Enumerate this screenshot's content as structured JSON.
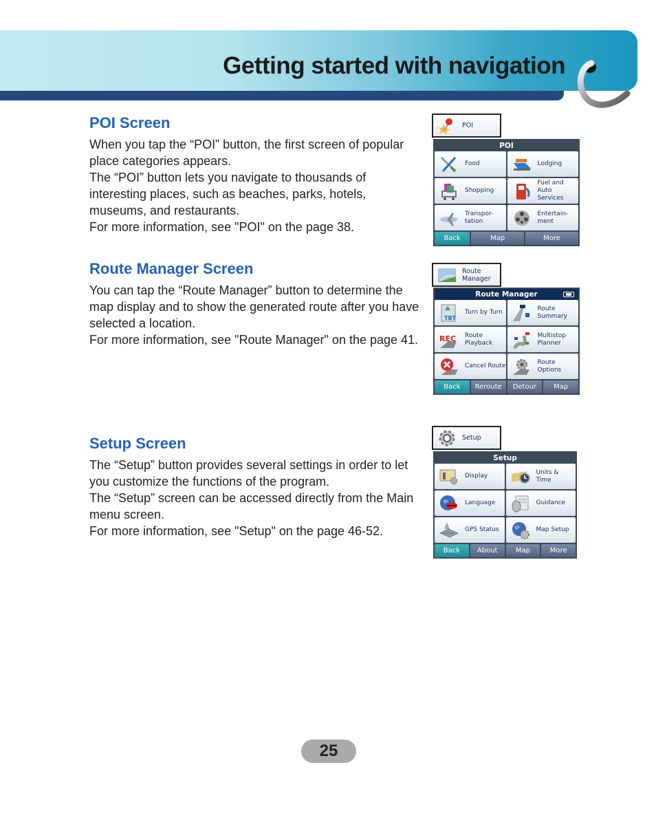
{
  "header": {
    "title": "Getting started with navigation"
  },
  "sections": [
    {
      "heading": "POI Screen",
      "paragraphs": [
        "When you tap the “POI” button, the first screen of popular place categories appears.",
        "The “POI” button lets you navigate to thousands of interesting places, such as beaches, parks, hotels, museums, and restaurants.",
        "For more information, see \"POI\" on the page 38."
      ]
    },
    {
      "heading": "Route Manager Screen",
      "paragraphs": [
        "You can tap the “Route Manager” button to determine the map display and to show the generated route after you have selected a location.",
        "For more information, see \"Route Manager\" on the page 41."
      ]
    },
    {
      "heading": "Setup Screen",
      "paragraphs": [
        "The “Setup” button provides several settings in order to let you customize the functions of the program.",
        "The “Setup” screen can be accessed directly from the Main menu screen.",
        "For more information, see \"Setup\" on the page 46-52."
      ]
    }
  ],
  "screens": {
    "poi": {
      "shortcut_label": "POI",
      "shortcut_icon": "pushpin-star-icon",
      "title": "POI",
      "tiles": [
        {
          "label": "Food",
          "icon": "fork-knife-icon"
        },
        {
          "label": "Lodging",
          "icon": "bed-icon"
        },
        {
          "label": "Shopping",
          "icon": "shopping-cart-icon"
        },
        {
          "label": "Fuel and Auto Services",
          "icon": "fuel-pump-icon"
        },
        {
          "label": "Transpor-tation",
          "icon": "airplane-icon"
        },
        {
          "label": "Entertain-ment",
          "icon": "film-reel-icon"
        }
      ],
      "buttons": [
        "Back",
        "Map",
        "More"
      ]
    },
    "route_manager": {
      "shortcut_label": "Route Manager",
      "shortcut_icon": "route-map-icon",
      "title": "Route Manager",
      "tiles": [
        {
          "label": "Turn by Turn",
          "icon": "turn-by-turn-icon"
        },
        {
          "label": "Route Summary",
          "icon": "route-summary-icon"
        },
        {
          "label": "Route Playback",
          "icon": "rec-playback-icon"
        },
        {
          "label": "Multistop Planner",
          "icon": "multistop-flags-icon"
        },
        {
          "label": "Cancel Route",
          "icon": "cancel-x-icon"
        },
        {
          "label": "Route Options",
          "icon": "route-gear-icon"
        }
      ],
      "buttons": [
        "Back",
        "Reroute",
        "Detour",
        "Map"
      ]
    },
    "setup": {
      "shortcut_label": "Setup",
      "shortcut_icon": "gear-icon",
      "title": "Setup",
      "tiles": [
        {
          "label": "Display",
          "icon": "display-icon"
        },
        {
          "label": "Units & Time",
          "icon": "clock-ruler-icon"
        },
        {
          "label": "Language",
          "icon": "globe-lips-icon"
        },
        {
          "label": "Guidance",
          "icon": "speaker-icon"
        },
        {
          "label": "GPS Status",
          "icon": "satellite-icon"
        },
        {
          "label": "Map Setup",
          "icon": "globe-gear-icon"
        }
      ],
      "buttons": [
        "Back",
        "About",
        "Map",
        "More"
      ]
    }
  },
  "page_number": "25",
  "colors": {
    "heading": "#2462b3",
    "banner_dark": "#26497c",
    "banner_light": "#c2eaf2",
    "back_button": "#1f8c96"
  }
}
